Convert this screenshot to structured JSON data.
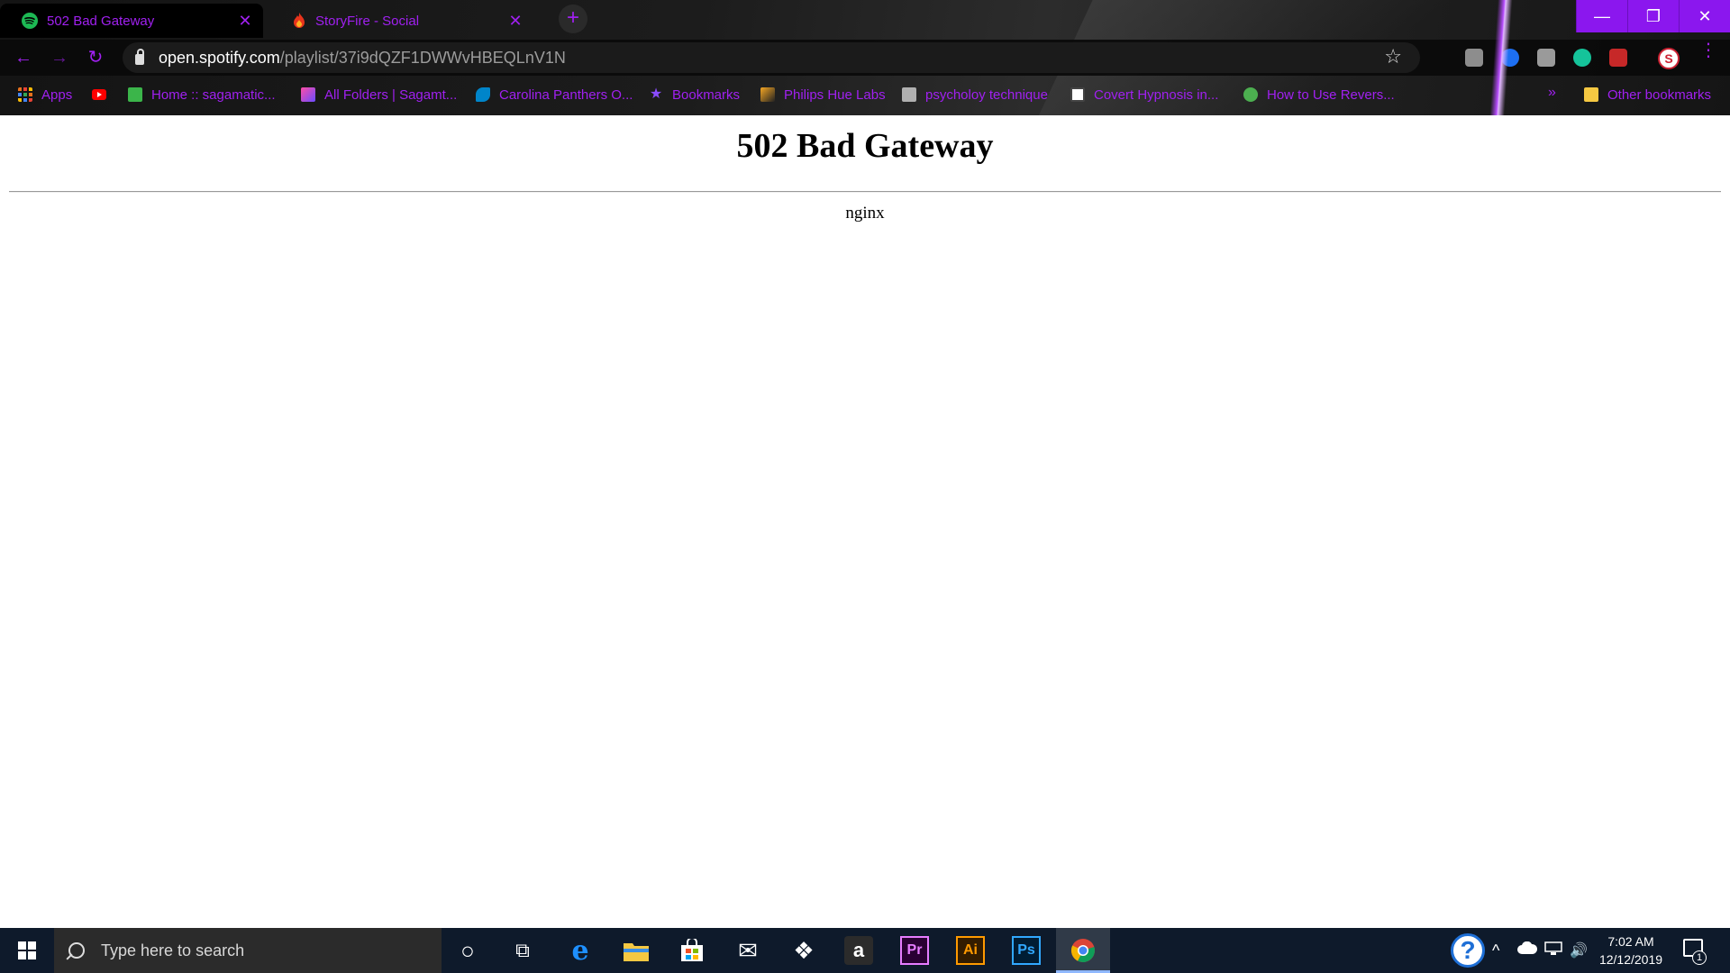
{
  "browser": {
    "tabs": [
      {
        "title": "502 Bad Gateway",
        "icon": "spotify-icon",
        "icon_color": "#1db954",
        "active": true
      },
      {
        "title": "StoryFire - Social",
        "icon": "flame-icon",
        "icon_color": "#e8341c",
        "active": false
      }
    ],
    "tab_close_symbol": "✕",
    "new_tab_symbol": "+",
    "window_controls": {
      "minimize": "—",
      "restore": "❐",
      "close": "✕"
    },
    "nav": {
      "back": "←",
      "forward": "→",
      "reload": "↻"
    },
    "url": {
      "host": "open.spotify.com",
      "path": "/playlist/37i9dQZF1DWWvHBEQLnV1N"
    },
    "bookmark_star": "☆",
    "profile_initial": "S",
    "menu_symbol": "⋮",
    "accent_color": "#a020f0",
    "bookmarks": [
      {
        "label": "Apps",
        "icon": "apps-grid-icon",
        "color": "#e8711c"
      },
      {
        "label": "",
        "icon": "youtube-icon",
        "color": "#ff0000"
      },
      {
        "label": "Home :: sagamatic...",
        "icon": "home-doc-icon",
        "color": "#3bb54a"
      },
      {
        "label": "All Folders | Sagamt...",
        "icon": "folder-app-icon",
        "color": "#8a4cff"
      },
      {
        "label": "Carolina Panthers O...",
        "icon": "panther-icon",
        "color": "#0085ca"
      },
      {
        "label": "Bookmarks",
        "icon": "star-icon",
        "color": "#8a4cff"
      },
      {
        "label": "Philips Hue Labs",
        "icon": "hue-icon",
        "color": "#f5a623"
      },
      {
        "label": "psycholoy technique",
        "icon": "io9-icon",
        "color": "#b0b0b0"
      },
      {
        "label": "Covert Hypnosis in...",
        "icon": "hypnosis-icon",
        "color": "#ffffff"
      },
      {
        "label": "How to Use Revers...",
        "icon": "site-icon",
        "color": "#4caf50"
      }
    ],
    "bookmarks_more": "»",
    "other_bookmarks": "Other bookmarks"
  },
  "page": {
    "heading": "502 Bad Gateway",
    "server": "nginx"
  },
  "taskbar": {
    "search_placeholder": "Type here to search",
    "apps": [
      {
        "name": "cortana-icon",
        "glyph": "○"
      },
      {
        "name": "task-view-icon",
        "glyph": "⧉"
      },
      {
        "name": "edge-icon",
        "glyph": "e"
      },
      {
        "name": "file-explorer-icon",
        "glyph": ""
      },
      {
        "name": "store-icon",
        "glyph": ""
      },
      {
        "name": "mail-icon",
        "glyph": "✉"
      },
      {
        "name": "dropbox-icon",
        "glyph": "❖"
      },
      {
        "name": "amazon-icon",
        "glyph": "a"
      },
      {
        "name": "premiere-icon",
        "glyph": "Pr"
      },
      {
        "name": "illustrator-icon",
        "glyph": "Ai"
      },
      {
        "name": "photoshop-icon",
        "glyph": "Ps"
      },
      {
        "name": "chrome-icon",
        "glyph": ""
      }
    ],
    "help_symbol": "?",
    "tray_chevron": "^",
    "volume_symbol": "🔊",
    "clock_time": "7:02 AM",
    "clock_date": "12/12/2019",
    "notification_count": "1"
  }
}
